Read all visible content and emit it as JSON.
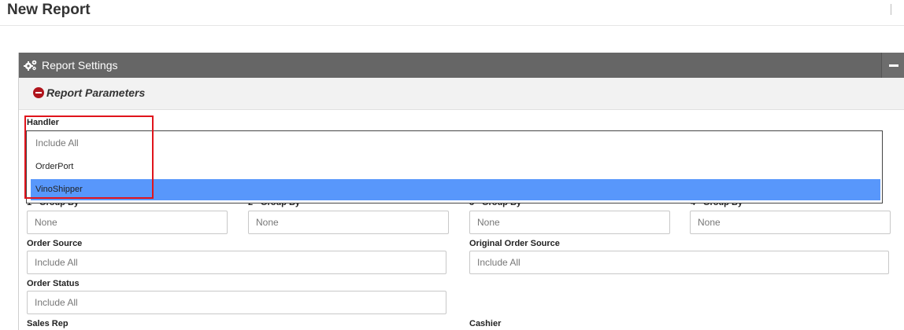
{
  "page": {
    "title": "New Report"
  },
  "panel": {
    "title": "Report Settings",
    "icon": "gears-icon",
    "collapse_icon": "minus-icon"
  },
  "parameters": {
    "title": "Report Parameters",
    "icon": "minus-circle-icon"
  },
  "handler": {
    "label": "Handler",
    "placeholder": "Include All",
    "options": [
      "OrderPort",
      "VinoShipper"
    ],
    "highlighted_option": "VinoShipper",
    "highlight_color": "#5897fb",
    "annotation_color": "#e0141c"
  },
  "group_by": [
    {
      "label": "1 - Group By",
      "value": "None"
    },
    {
      "label": "2 - Group By",
      "value": "None"
    },
    {
      "label": "3 - Group By",
      "value": "None"
    },
    {
      "label": "4 - Group By",
      "value": "None"
    }
  ],
  "order_source": {
    "label": "Order Source",
    "placeholder": "Include All"
  },
  "original_order_source": {
    "label": "Original Order Source",
    "placeholder": "Include All"
  },
  "order_status": {
    "label": "Order Status",
    "placeholder": "Include All"
  },
  "sales_rep": {
    "label": "Sales Rep"
  },
  "cashier": {
    "label": "Cashier"
  },
  "colors": {
    "header_bg": "#666666",
    "accent_red": "#b0141c"
  }
}
